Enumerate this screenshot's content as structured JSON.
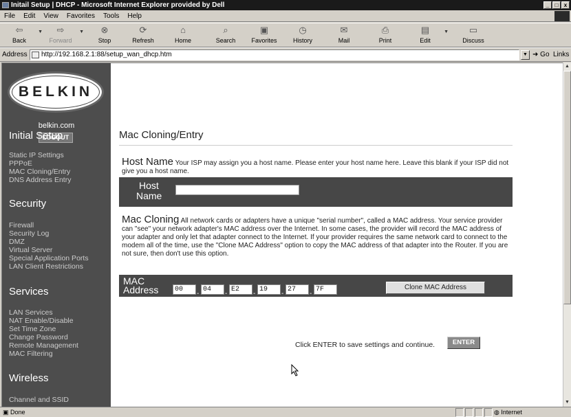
{
  "window": {
    "title": "Initail Setup | DHCP - Microsoft Internet Explorer provided by Dell"
  },
  "menu": [
    "File",
    "Edit",
    "View",
    "Favorites",
    "Tools",
    "Help"
  ],
  "toolbar": {
    "back": "Back",
    "forward": "Forward",
    "stop": "Stop",
    "refresh": "Refresh",
    "home": "Home",
    "search": "Search",
    "favorites": "Favorites",
    "history": "History",
    "mail": "Mail",
    "print": "Print",
    "edit": "Edit",
    "discuss": "Discuss"
  },
  "address": {
    "label": "Address",
    "url": "http://192.168.2.1:88/setup_wan_dhcp.htm",
    "go": "Go",
    "links": "Links"
  },
  "sidebar": {
    "logo": "BELKIN",
    "site": "belkin.com",
    "logout": "LOGOUT",
    "sections": [
      {
        "title": "Initial Setup",
        "items": [
          "Static IP Settings",
          "PPPoE",
          "MAC Cloning/Entry",
          "DNS Address Entry"
        ]
      },
      {
        "title": "Security",
        "items": [
          "Firewall",
          "Security Log",
          "DMZ",
          "Virtual Server",
          "Special Application Ports",
          "LAN Client Restrictions"
        ]
      },
      {
        "title": "Services",
        "items": [
          "LAN Services",
          "NAT Enable/Disable",
          "Set Time Zone",
          "Change Password",
          "Remote Management",
          "MAC Filtering"
        ]
      },
      {
        "title": "Wireless",
        "items": [
          "Channel and SSID"
        ]
      }
    ]
  },
  "main": {
    "heading": "Mac Cloning/Entry",
    "host": {
      "title": "Host Name",
      "help": "Your ISP may assign you a host name. Please enter your host name here. Leave this blank if your ISP did not give you a host name.",
      "label_line1": "Host",
      "label_line2": "Name",
      "value": ""
    },
    "mac": {
      "title": "Mac Cloning",
      "help": "All network cards or adapters have a unique \"serial number\", called a MAC address. Your service provider can \"see\" your network adapter's MAC address over the Internet. In some cases, the provider will record the MAC address of your adapter and only let that adapter connect to the Internet. If your provider requires the same network card to connect to the modem all of the time, use the \"Clone MAC Address\" option to copy the MAC address of that adapter into the Router. If you are not sure, then don't use this option.",
      "label_line1": "MAC",
      "label_line2": "Address",
      "octets": [
        "00",
        "04",
        "E2",
        "19",
        "27",
        "7F"
      ],
      "clone_button": "Clone MAC Address"
    },
    "enter_text": "Click ENTER to save settings and continue.",
    "enter_button": "ENTER"
  },
  "status": {
    "text": "Done",
    "zone": "Internet"
  }
}
